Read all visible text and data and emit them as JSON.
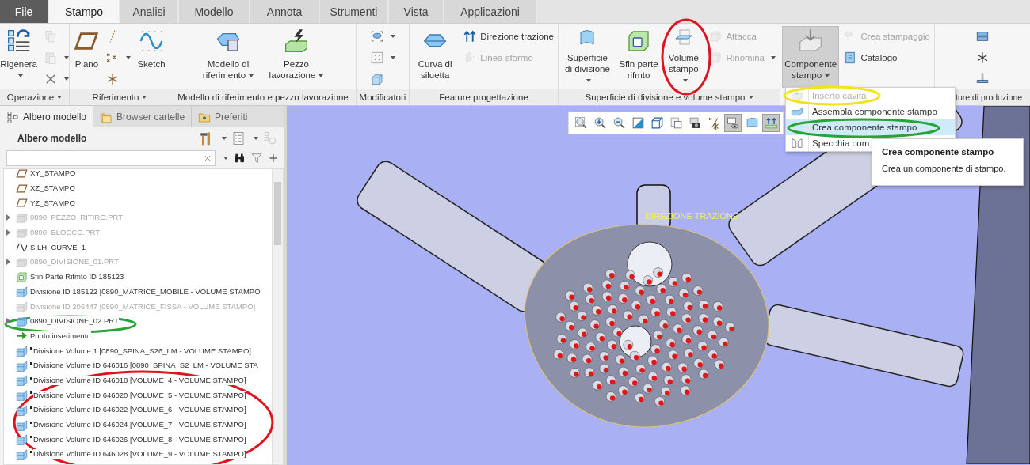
{
  "tabs": [
    {
      "label": "File",
      "kind": "file",
      "selected": false
    },
    {
      "label": "Stampo",
      "kind": "tab",
      "selected": true
    },
    {
      "label": "Analisi",
      "kind": "tab",
      "selected": false
    },
    {
      "label": "Modello",
      "kind": "tab",
      "selected": false
    },
    {
      "label": "Annota",
      "kind": "tab",
      "selected": false
    },
    {
      "label": "Strumenti",
      "kind": "tab",
      "selected": false
    },
    {
      "label": "Vista",
      "kind": "tab",
      "selected": false
    },
    {
      "label": "Applicazioni",
      "kind": "tab",
      "selected": false
    }
  ],
  "ribbon": {
    "groups": [
      {
        "label": "Operazione",
        "dropdown": true,
        "columns": [
          {
            "kind": "large",
            "label": "Rigenera",
            "dropdown": true,
            "disabled": false,
            "pressed": false
          },
          {
            "kind": "stack",
            "items": [
              {
                "dropdown": false,
                "disabled": true
              },
              {
                "dropdown": true,
                "disabled": true
              },
              {
                "dropdown": true,
                "disabled": false
              }
            ]
          }
        ]
      },
      {
        "label": "Riferimento",
        "dropdown": true,
        "columns": [
          {
            "kind": "large",
            "label": "Piano",
            "dropdown": false,
            "disabled": false,
            "pressed": false
          },
          {
            "kind": "stack",
            "items": [
              {
                "dropdown": false,
                "disabled": false
              },
              {
                "dropdown": true,
                "disabled": false
              },
              {
                "dropdown": false,
                "disabled": false
              }
            ]
          },
          {
            "kind": "large",
            "label": "Sketch",
            "dropdown": false,
            "disabled": false,
            "pressed": false
          }
        ]
      },
      {
        "label": "Modello di riferimento e pezzo lavorazione",
        "dropdown": false,
        "columns": [
          {
            "kind": "large",
            "label": "Modello di riferimento",
            "dropdown": true,
            "disabled": false,
            "pressed": false
          },
          {
            "kind": "large",
            "label": "Pezzo lavorazione",
            "dropdown": true,
            "disabled": false,
            "pressed": false
          }
        ]
      },
      {
        "label": "Modificatori",
        "dropdown": false,
        "columns": [
          {
            "kind": "stack",
            "items": [
              {
                "dropdown": true,
                "disabled": false
              },
              {
                "dropdown": true,
                "disabled": false
              },
              {
                "dropdown": false,
                "disabled": false
              }
            ]
          }
        ]
      },
      {
        "label": "Feature progettazione",
        "dropdown": false,
        "columns": [
          {
            "kind": "large",
            "label": "Curva di siluetta",
            "dropdown": false,
            "disabled": false,
            "pressed": false
          },
          {
            "kind": "stack",
            "items": [
              {
                "label": "Direzione trazione",
                "dropdown": false,
                "disabled": false
              },
              {
                "label": "Linea sformo",
                "dropdown": false,
                "disabled": true
              }
            ]
          }
        ]
      },
      {
        "label": "Superficie di divisione e volume stampo",
        "dropdown": true,
        "columns": [
          {
            "kind": "large",
            "label": "Superficie di divisione",
            "dropdown": true,
            "disabled": false,
            "pressed": false
          },
          {
            "kind": "large",
            "label": "Sfin parte rifmto",
            "dropdown": false,
            "disabled": false,
            "pressed": false
          },
          {
            "kind": "large",
            "label": "Volume stampo",
            "dropdown": true,
            "disabled": false,
            "pressed": false
          },
          {
            "kind": "stack",
            "items": [
              {
                "label": "Attacca",
                "dropdown": false,
                "disabled": true
              },
              {
                "label": "Rinomina",
                "dropdown": true,
                "disabled": true
              }
            ]
          }
        ]
      },
      {
        "columns": [
          {
            "kind": "large",
            "label": "Componente stampo",
            "dropdown": true,
            "disabled": false,
            "pressed": true
          },
          {
            "kind": "stack",
            "items": [
              {
                "label": "Crea stampaggio",
                "dropdown": false,
                "disabled": true
              },
              {
                "label": "Catalogo",
                "dropdown": false,
                "disabled": false
              }
            ]
          }
        ]
      },
      {
        "label": "ture di produzione",
        "dropdown": false,
        "columns": [
          {
            "kind": "stack",
            "items": [
              {
                "dropdown": false,
                "disabled": false
              },
              {
                "dropdown": false,
                "disabled": false
              },
              {
                "dropdown": false,
                "disabled": false
              }
            ]
          }
        ]
      }
    ]
  },
  "menu": {
    "items": [
      {
        "label": "Inserto cavità",
        "disabled": true,
        "highlighted": false
      },
      {
        "label": "Assembla componente stampo",
        "disabled": false,
        "highlighted": false
      },
      {
        "label": "Crea componente stampo",
        "disabled": false,
        "highlighted": true
      },
      {
        "label": "Specchia com",
        "disabled": false,
        "highlighted": false
      }
    ]
  },
  "tooltip": {
    "title": "Crea componente stampo",
    "text": "Crea un componente di stampo."
  },
  "panel": {
    "tabs": [
      {
        "label": "Albero modello",
        "selected": true
      },
      {
        "label": "Browser cartelle",
        "selected": false
      },
      {
        "label": "Preferiti",
        "selected": false
      }
    ],
    "title": "Albero modello",
    "tree": [
      {
        "label": "XY_STAMPO",
        "kind": "plane",
        "expandable": false,
        "dimmed": false,
        "flagged": false
      },
      {
        "label": "XZ_STAMPO",
        "kind": "plane",
        "expandable": false,
        "dimmed": false,
        "flagged": false
      },
      {
        "label": "YZ_STAMPO",
        "kind": "plane",
        "expandable": false,
        "dimmed": false,
        "flagged": false
      },
      {
        "label": "0890_PEZZO_RITIRO.PRT",
        "kind": "part",
        "expandable": true,
        "dimmed": true,
        "flagged": false
      },
      {
        "label": "0890_BLOCCO.PRT",
        "kind": "part",
        "expandable": true,
        "dimmed": true,
        "flagged": false
      },
      {
        "label": "SILH_CURVE_1",
        "kind": "curve",
        "expandable": false,
        "dimmed": false,
        "flagged": false
      },
      {
        "label": "0890_DIVISIONE_01.PRT",
        "kind": "part",
        "expandable": true,
        "dimmed": true,
        "flagged": false
      },
      {
        "label": "Sfin Parte Rifmto ID 185123",
        "kind": "shutoff",
        "expandable": false,
        "dimmed": false,
        "flagged": false
      },
      {
        "label": "Divisione ID 185122 [0890_MATRICE_MOBILE - VOLUME STAMPO",
        "kind": "volume",
        "expandable": false,
        "dimmed": false,
        "flagged": false
      },
      {
        "label": "Divisione ID 206447 [0890_MATRICE_FISSA - VOLUME STAMPO]",
        "kind": "volume",
        "expandable": false,
        "dimmed": true,
        "flagged": false
      },
      {
        "label": "0890_DIVISIONE_02.PRT",
        "kind": "part",
        "expandable": true,
        "dimmed": false,
        "flagged": false
      },
      {
        "label": "Punto inserimento",
        "kind": "insert",
        "expandable": false,
        "dimmed": false,
        "flagged": false
      },
      {
        "label": "Divisione Volume 1 [0890_SPINA_S26_LM - VOLUME STAMPO]",
        "kind": "volume",
        "expandable": false,
        "dimmed": false,
        "flagged": true
      },
      {
        "label": "Divisione Volume ID 646016 [0890_SPINA_S2_LM - VOLUME STA",
        "kind": "volume",
        "expandable": false,
        "dimmed": false,
        "flagged": true
      },
      {
        "label": "Divisione Volume ID 646018 [VOLUME_4 - VOLUME STAMPO]",
        "kind": "volume",
        "expandable": false,
        "dimmed": false,
        "flagged": true
      },
      {
        "label": "Divisione Volume ID 646020 [VOLUME_5 - VOLUME STAMPO]",
        "kind": "volume",
        "expandable": false,
        "dimmed": false,
        "flagged": true
      },
      {
        "label": "Divisione Volume ID 646022 [VOLUME_6 - VOLUME STAMPO]",
        "kind": "volume",
        "expandable": false,
        "dimmed": false,
        "flagged": true
      },
      {
        "label": "Divisione Volume ID 646024 [VOLUME_7 - VOLUME STAMPO]",
        "kind": "volume",
        "expandable": false,
        "dimmed": false,
        "flagged": true
      },
      {
        "label": "Divisione Volume ID 646026 [VOLUME_8 - VOLUME STAMPO]",
        "kind": "volume",
        "expandable": false,
        "dimmed": false,
        "flagged": true
      },
      {
        "label": "Divisione Volume ID 646028 [VOLUME_9 - VOLUME STAMPO]",
        "kind": "volume",
        "expandable": false,
        "dimmed": false,
        "flagged": true
      }
    ]
  },
  "viewport": {
    "toolbar": [
      {
        "pressed": false
      },
      {
        "pressed": false
      },
      {
        "pressed": false
      },
      {
        "pressed": false
      },
      {
        "pressed": false
      },
      {
        "pressed": false
      },
      {
        "pressed": false
      },
      {
        "pressed": false
      },
      {
        "pressed": true
      },
      {
        "pressed": false
      },
      {
        "pressed": true
      }
    ],
    "label": "DIREZIONE TRAZIONE"
  },
  "annotations": [
    {
      "color": "#e0141e"
    },
    {
      "color": "#e0141e"
    },
    {
      "color": "#27a33a"
    },
    {
      "color": "#27a33a"
    },
    {
      "color": "#f2e41a"
    }
  ]
}
